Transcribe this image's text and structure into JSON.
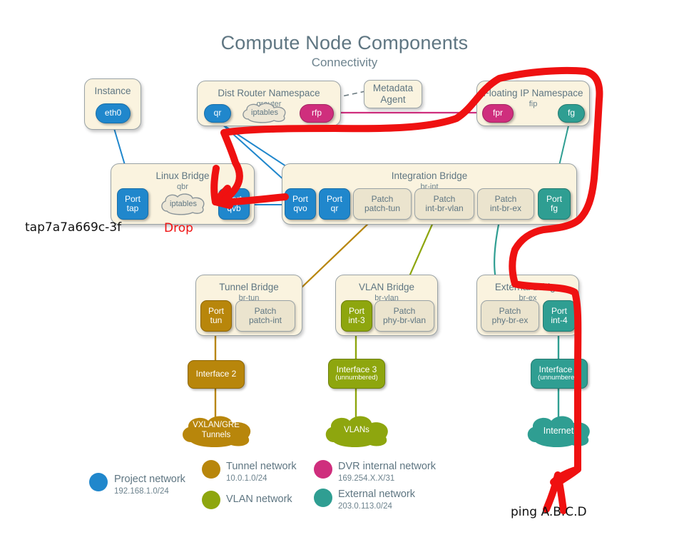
{
  "header": {
    "title": "Compute Node Components",
    "subtitle": "Connectivity"
  },
  "colors": {
    "project": "#2087cc",
    "tunnel": "#b8860b",
    "vlan": "#8ea60e",
    "dvr": "#cf2e7d",
    "external": "#2f9e92",
    "box_fill": "#faf3df",
    "patch_fill": "#ebe4ce",
    "annotation_red": "#ef1111"
  },
  "boxes": {
    "instance": {
      "title": "Instance",
      "sub": ""
    },
    "qrouter": {
      "title": "Dist Router Namespace",
      "sub": "qrouter"
    },
    "metadata": {
      "title": "Metadata",
      "sub": "Agent"
    },
    "fip": {
      "title": "Floating IP Namespace",
      "sub": "fip"
    },
    "linuxbridge": {
      "title": "Linux Bridge",
      "sub": "qbr"
    },
    "brint": {
      "title": "Integration Bridge",
      "sub": "br-int"
    },
    "brtun": {
      "title": "Tunnel Bridge",
      "sub": "br-tun"
    },
    "brvlan": {
      "title": "VLAN Bridge",
      "sub": "br-vlan"
    },
    "brex": {
      "title": "External Bridge",
      "sub": "br-ex"
    }
  },
  "ports": {
    "eth0": {
      "l1": "eth0",
      "l2": ""
    },
    "qr_ns": {
      "l1": "qr",
      "l2": ""
    },
    "iptables_ns": {
      "l1": "iptables"
    },
    "rfp": {
      "l1": "rfp",
      "l2": ""
    },
    "fpr": {
      "l1": "fpr",
      "l2": ""
    },
    "fg_ns": {
      "l1": "fg",
      "l2": ""
    },
    "port_tap": {
      "l1": "Port",
      "l2": "tap"
    },
    "iptables_qbr": {
      "l1": "iptables"
    },
    "port_qvb": {
      "l1": "Port",
      "l2": "qvb"
    },
    "port_qvo": {
      "l1": "Port",
      "l2": "qvo"
    },
    "port_qr": {
      "l1": "Port",
      "l2": "qr"
    },
    "patch_tun": {
      "l1": "Patch",
      "l2": "patch-tun"
    },
    "patch_intbrvlan": {
      "l1": "Patch",
      "l2": "int-br-vlan"
    },
    "patch_intbrex": {
      "l1": "Patch",
      "l2": "int-br-ex"
    },
    "port_fg": {
      "l1": "Port",
      "l2": "fg"
    },
    "port_tun": {
      "l1": "Port",
      "l2": "tun"
    },
    "patch_int": {
      "l1": "Patch",
      "l2": "patch-int"
    },
    "port_int3": {
      "l1": "Port",
      "l2": "int-3"
    },
    "patch_phybrvlan": {
      "l1": "Patch",
      "l2": "phy-br-vlan"
    },
    "patch_phybrex": {
      "l1": "Patch",
      "l2": "phy-br-ex"
    },
    "port_int4": {
      "l1": "Port",
      "l2": "int-4"
    }
  },
  "interfaces": {
    "iface2": {
      "l1": "Interface 2",
      "l2": ""
    },
    "iface3": {
      "l1": "Interface 3",
      "l2": "(unnumbered)"
    },
    "iface4": {
      "l1": "Interface 4",
      "l2": "(unnumbered)"
    }
  },
  "net_clouds": {
    "tunnels": {
      "l1": "VXLAN/GRE",
      "l2": "Tunnels"
    },
    "vlans": {
      "l1": "VLANs",
      "l2": ""
    },
    "internet": {
      "l1": "Internet",
      "l2": ""
    }
  },
  "legend": [
    {
      "name": "Project network",
      "sub": "192.168.1.0/24",
      "color": "#2087cc"
    },
    {
      "name": "Tunnel network",
      "sub": "10.0.1.0/24",
      "color": "#b8860b"
    },
    {
      "name": "VLAN network",
      "sub": "",
      "color": "#8ea60e"
    },
    {
      "name": "DVR internal network",
      "sub": "169.254.X.X/31",
      "color": "#cf2e7d"
    },
    {
      "name": "External network",
      "sub": "203.0.113.0/24",
      "color": "#2f9e92"
    }
  ],
  "annotations": {
    "tap_device": "tap7a7a669c-3f",
    "drop": "Drop",
    "ping": "ping A.B.C.D"
  }
}
